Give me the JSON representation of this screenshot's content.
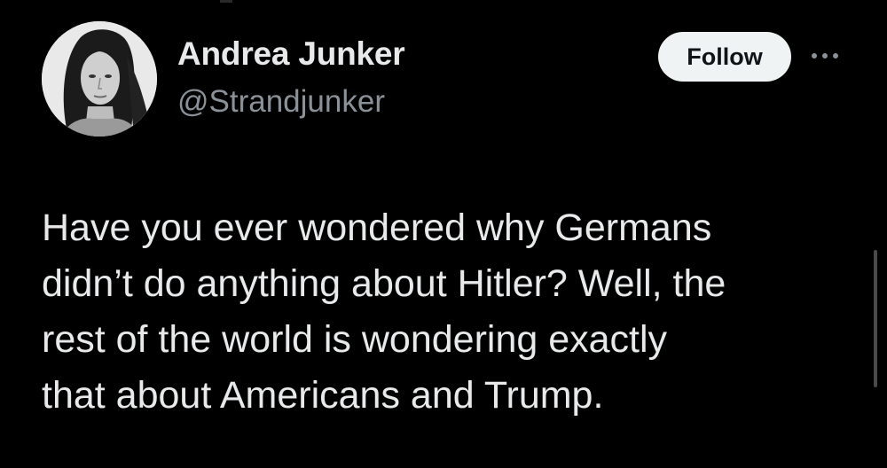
{
  "author": {
    "display_name": "Andrea Junker",
    "handle": "@Strandjunker",
    "avatar_icon": "profile-photo"
  },
  "actions": {
    "follow_label": "Follow",
    "more_icon": "ellipsis-icon"
  },
  "tweet": {
    "lines": [
      "Have you ever wondered why Germans",
      "didn’t do anything about Hitler? Well, the",
      "rest of the world is wondering exactly",
      "that about Americans and Trump."
    ]
  },
  "colors": {
    "background": "#000000",
    "primary_text": "#e7e9ea",
    "secondary_text": "#8b9198",
    "follow_button_bg": "#eff3f4",
    "follow_button_text": "#0f1419"
  }
}
